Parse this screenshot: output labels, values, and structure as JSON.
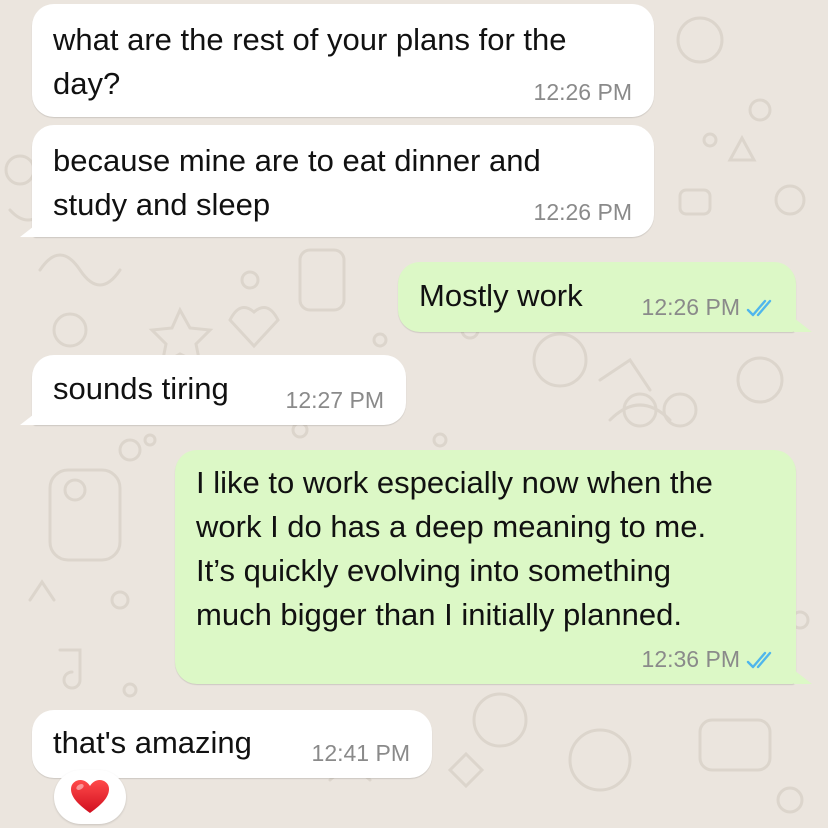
{
  "messages": [
    {
      "id": "m1",
      "direction": "incoming",
      "text": "what are the rest of your plans for the\nday?",
      "time": "12:26 PM"
    },
    {
      "id": "m2",
      "direction": "incoming",
      "text": "because mine are to eat dinner and\nstudy and sleep",
      "time": "12:26 PM"
    },
    {
      "id": "m3",
      "direction": "outgoing",
      "text": "Mostly work",
      "time": "12:26 PM",
      "status": "read"
    },
    {
      "id": "m4",
      "direction": "incoming",
      "text": "sounds tiring",
      "time": "12:27 PM"
    },
    {
      "id": "m5",
      "direction": "outgoing",
      "text": "I like to work especially now when the\nwork I do has a deep meaning to me.\nIt’s quickly evolving into something\nmuch bigger than I initially planned.",
      "time": "12:36 PM",
      "status": "read"
    },
    {
      "id": "m6",
      "direction": "incoming",
      "text": "that's amazing",
      "time": "12:41 PM"
    }
  ],
  "reaction": {
    "emoji": "heart-emoji",
    "on_message": "m6"
  },
  "colors": {
    "incoming_bubble": "#ffffff",
    "outgoing_bubble": "#dcf8c6",
    "read_ticks": "#4fb6ec",
    "timestamp": "#8a8a8a",
    "wallpaper": "#ebe5de"
  }
}
